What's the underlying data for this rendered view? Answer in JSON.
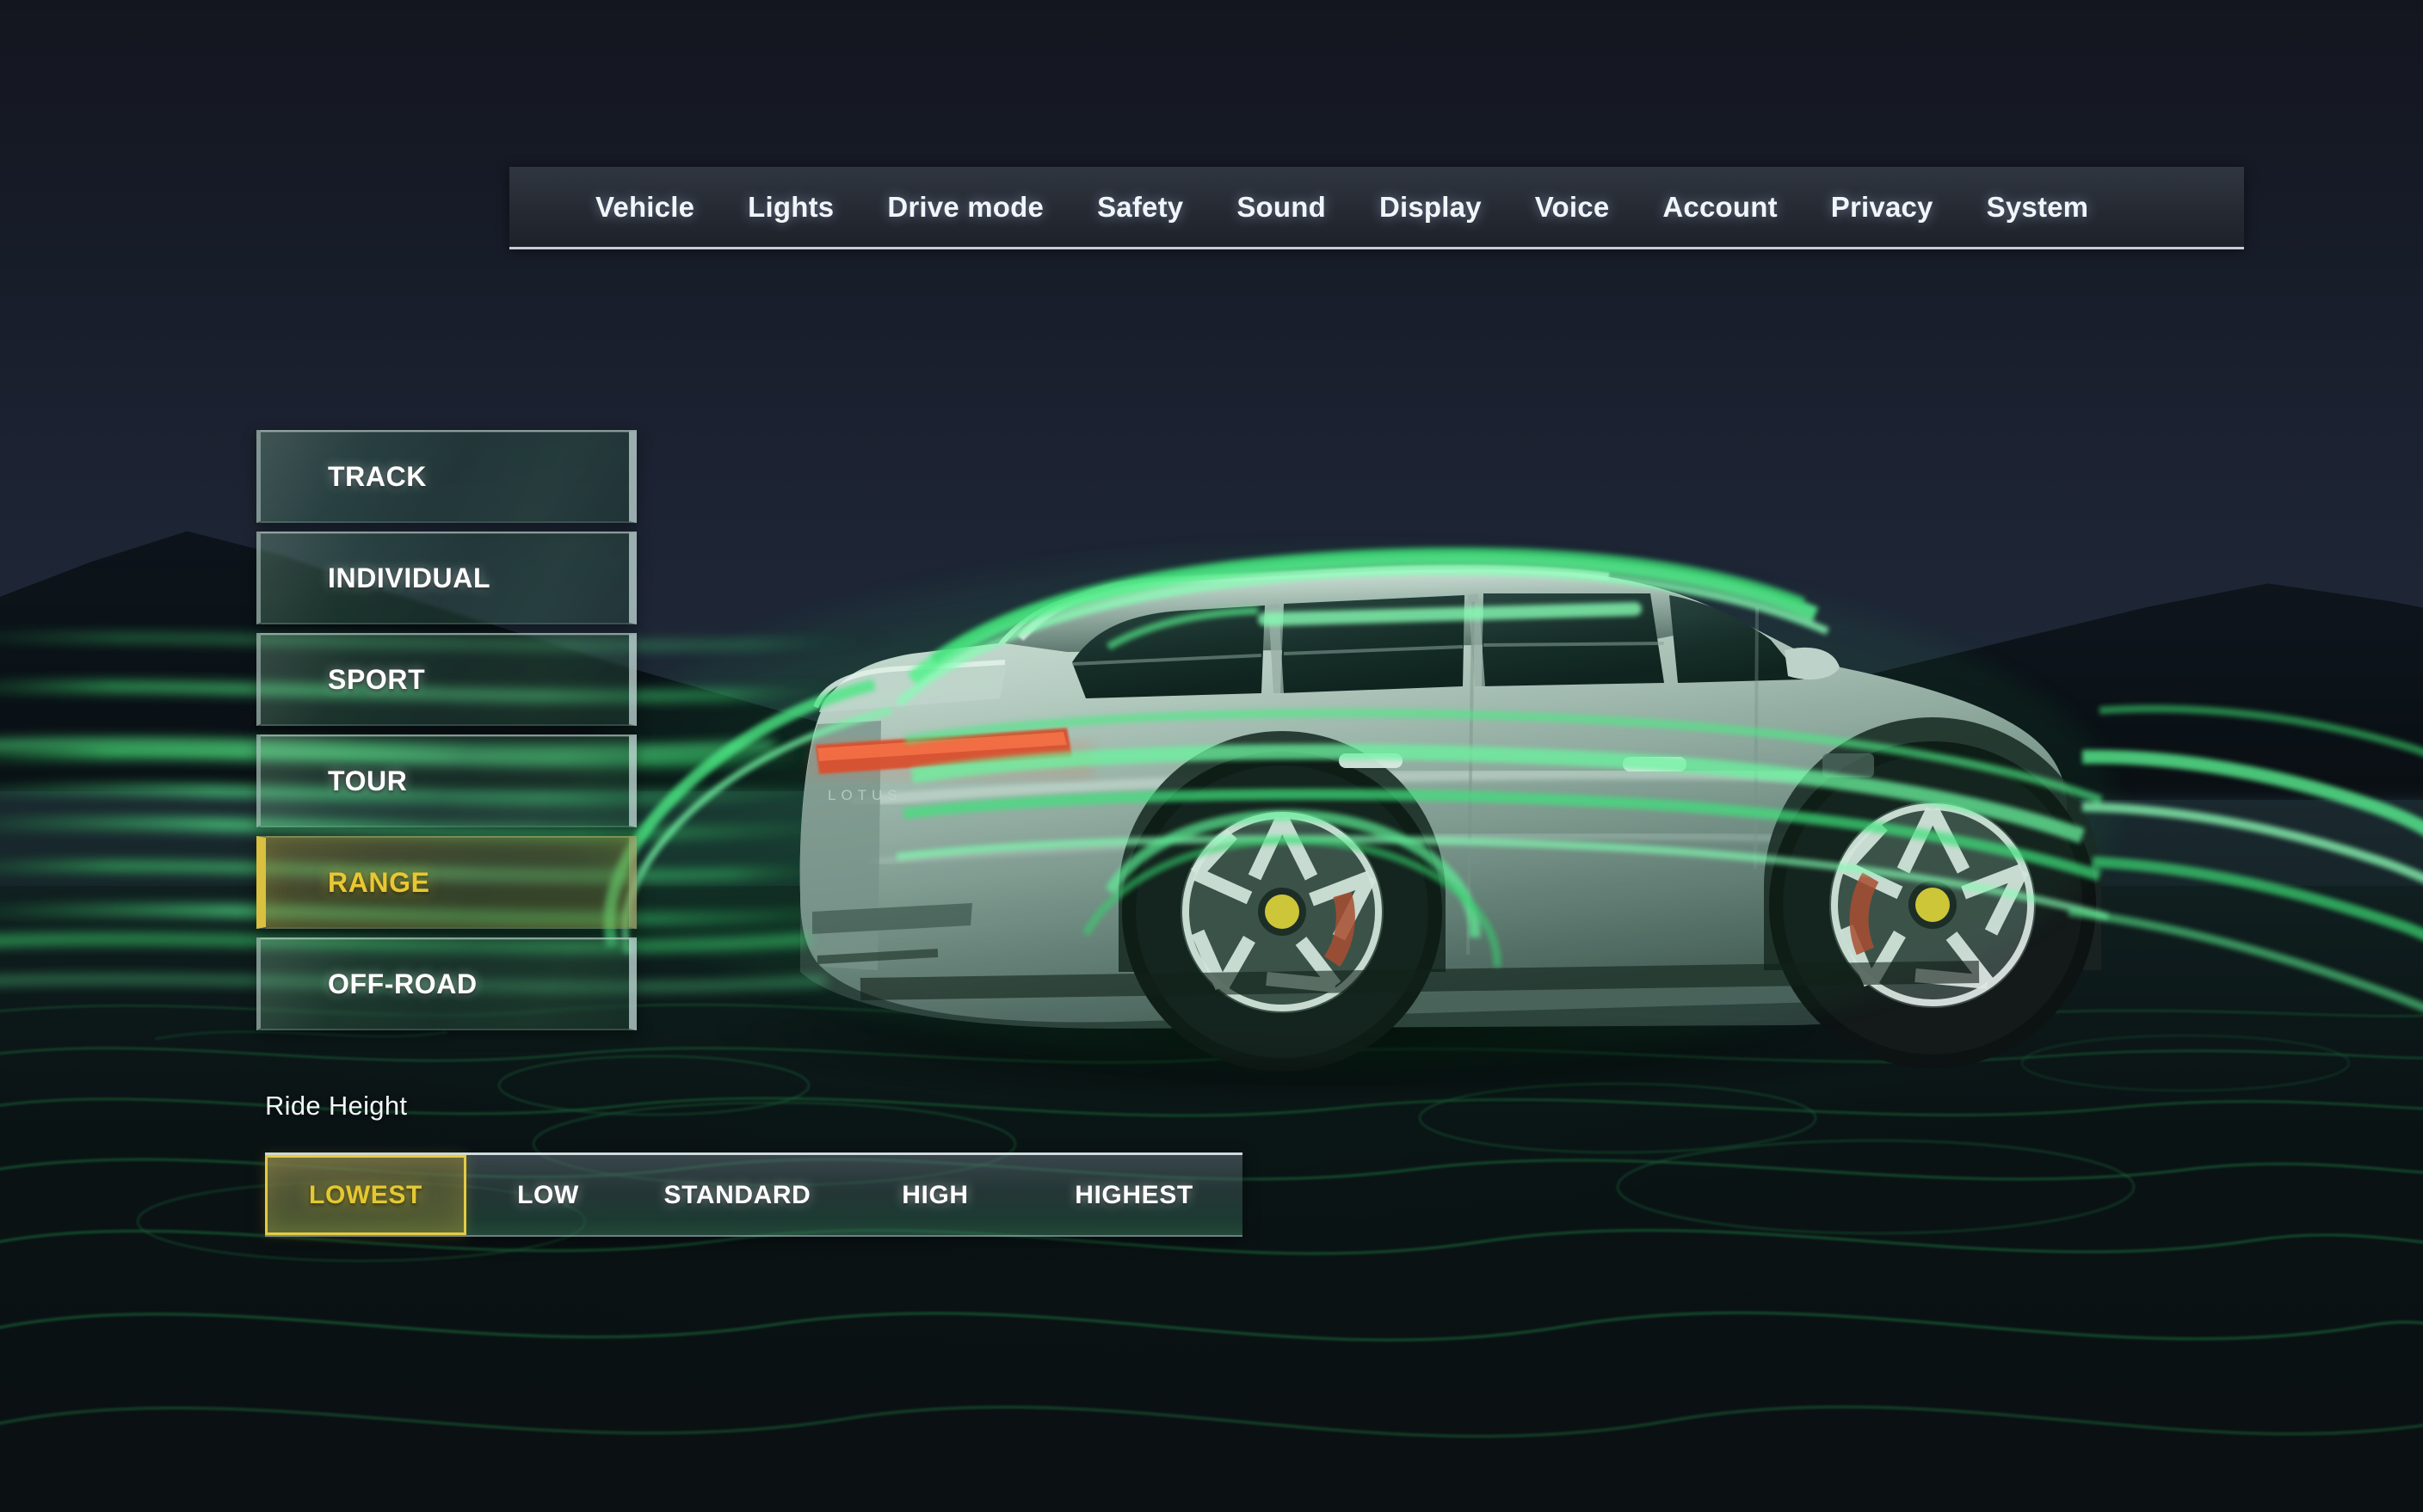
{
  "nav": {
    "items": [
      {
        "label": "Vehicle"
      },
      {
        "label": "Lights"
      },
      {
        "label": "Drive mode"
      },
      {
        "label": "Safety"
      },
      {
        "label": "Sound"
      },
      {
        "label": "Display"
      },
      {
        "label": "Voice"
      },
      {
        "label": "Account"
      },
      {
        "label": "Privacy"
      },
      {
        "label": "System"
      }
    ]
  },
  "drive_modes": {
    "selected": "RANGE",
    "items": [
      {
        "label": "TRACK",
        "selected": false
      },
      {
        "label": "INDIVIDUAL",
        "selected": false
      },
      {
        "label": "SPORT",
        "selected": false
      },
      {
        "label": "TOUR",
        "selected": false
      },
      {
        "label": "RANGE",
        "selected": true
      },
      {
        "label": "OFF-ROAD",
        "selected": false
      }
    ]
  },
  "ride_height": {
    "label": "Ride Height",
    "selected": "LOWEST",
    "options": [
      {
        "label": "LOWEST",
        "selected": true
      },
      {
        "label": "LOW",
        "selected": false
      },
      {
        "label": "STANDARD",
        "selected": false
      },
      {
        "label": "HIGH",
        "selected": false
      },
      {
        "label": "HIGHEST",
        "selected": false
      }
    ]
  },
  "scene": {
    "vehicle_badge": "LOTUS",
    "description": "Electric SUV side view with green airflow visualization streamlines"
  },
  "colors": {
    "accent_selected": "#e4c832",
    "accent_border": "#d9c040",
    "airflow_green": "#3fdc6e",
    "taillight_red": "#e2452a",
    "text_primary": "#ffffff",
    "nav_background": "#2b313b",
    "page_background": "#141720"
  }
}
